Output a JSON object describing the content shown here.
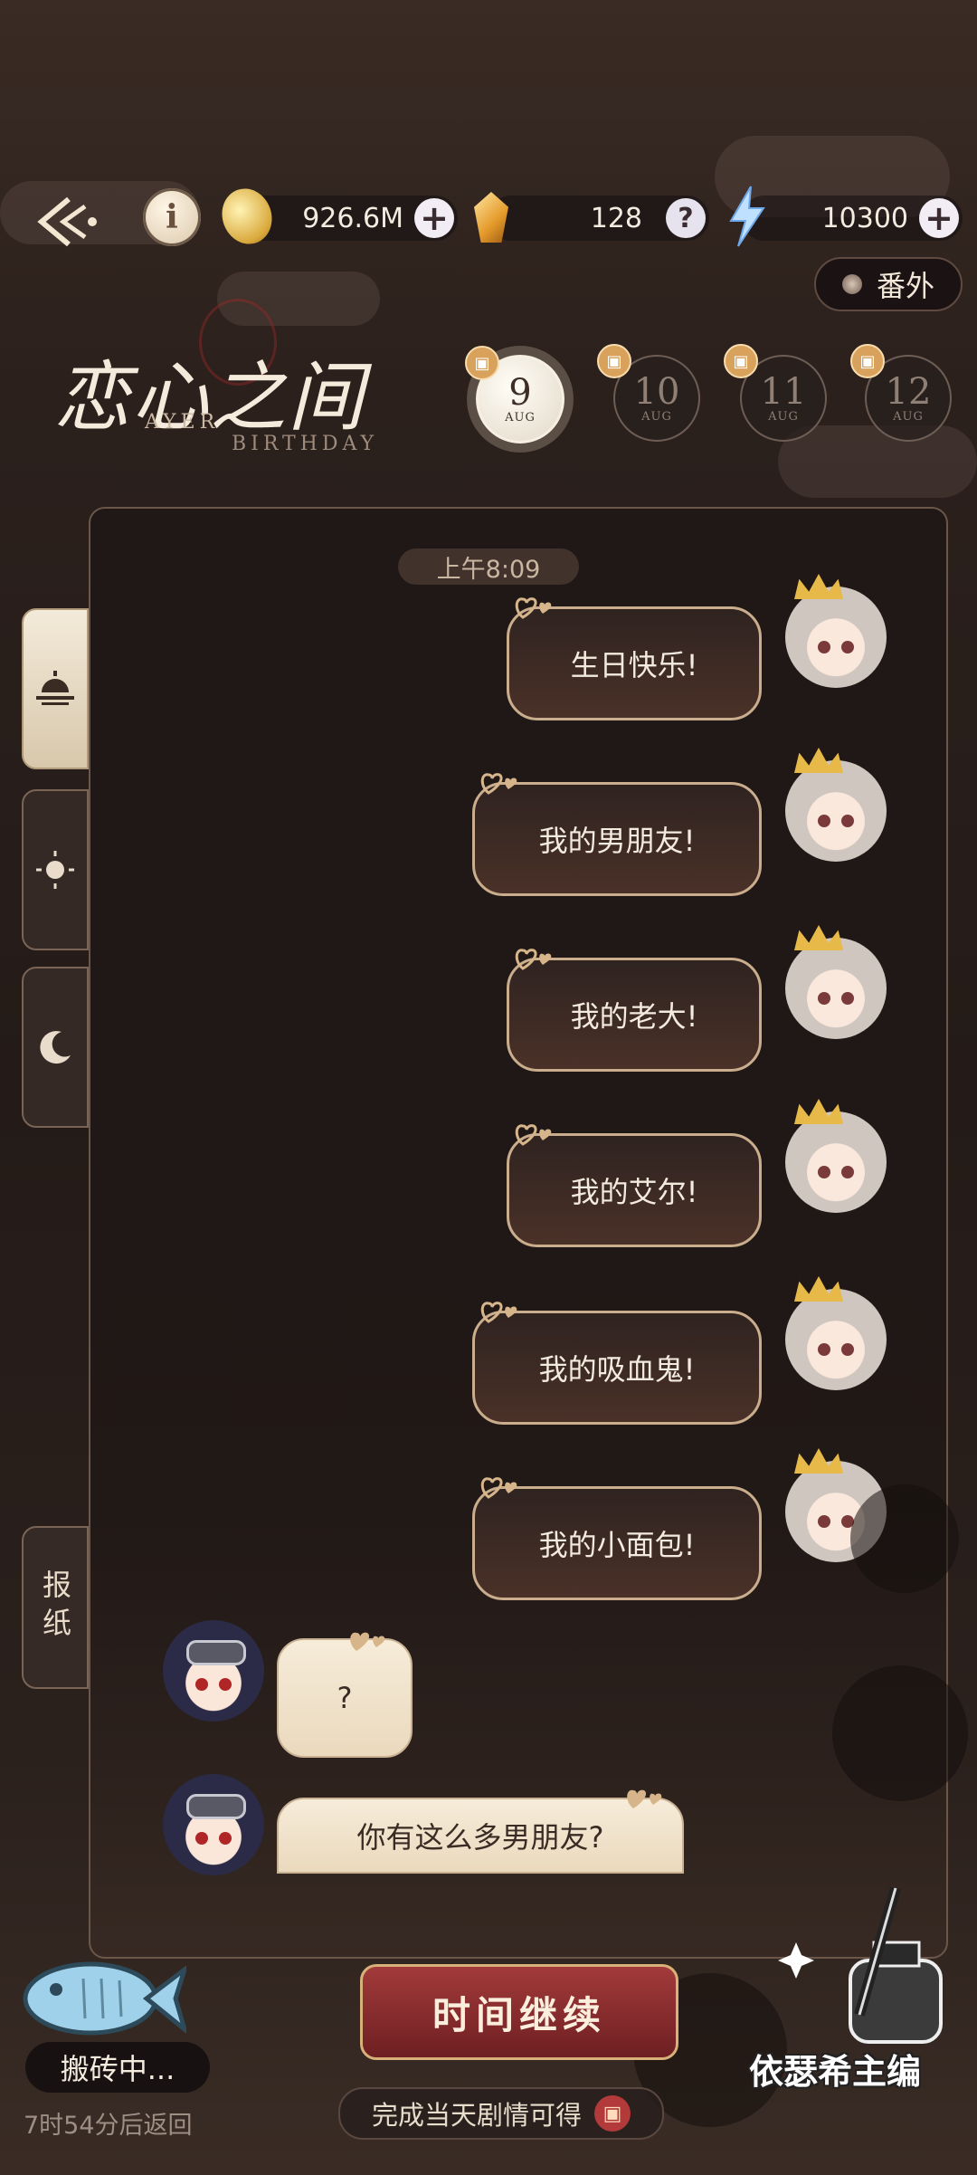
{
  "resources": {
    "gold": "926.6M",
    "crystal": "128",
    "energy": "10300"
  },
  "extra_label": "番外",
  "title": {
    "main": "恋心之间",
    "sub1": "AYER",
    "sub2": "BIRTHDAY"
  },
  "days": [
    {
      "num": "9",
      "month": "AUG"
    },
    {
      "num": "10",
      "month": "AUG"
    },
    {
      "num": "11",
      "month": "AUG"
    },
    {
      "num": "12",
      "month": "AUG"
    }
  ],
  "chat": {
    "time": "上午8:09",
    "right_messages": [
      "生日快乐!",
      "我的男朋友!",
      "我的老大!",
      "我的艾尔!",
      "我的吸血鬼!",
      "我的小面包!"
    ],
    "left_messages": [
      "?",
      "你有这么多男朋友?"
    ]
  },
  "newspaper_tab": "报纸",
  "continue_label": "时间继续",
  "reward_text": "完成当天剧情可得",
  "status": {
    "working": "搬砖中...",
    "return_time": "7时54分后返回"
  },
  "editor_label": "依瑟希主编",
  "colors": {
    "accent_gold": "#c9ad8c",
    "button_red": "#a23a3a",
    "background": "#241b18"
  }
}
